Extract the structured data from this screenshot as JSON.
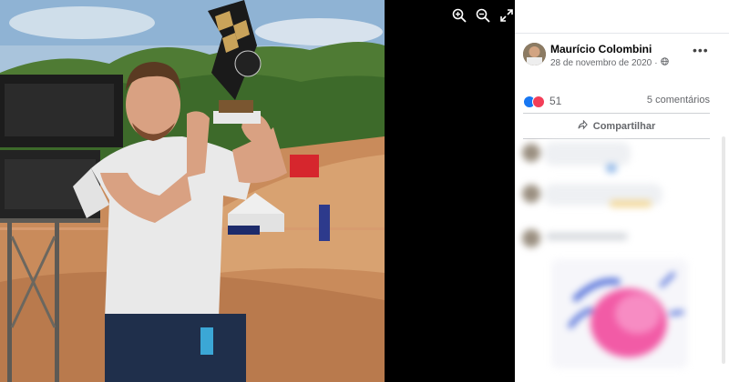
{
  "viewer": {
    "tools": [
      {
        "name": "zoom-in-icon"
      },
      {
        "name": "zoom-out-icon"
      },
      {
        "name": "fullscreen-icon"
      }
    ]
  },
  "post": {
    "author": "Maurício Colombini",
    "date": "28 de novembro de 2020",
    "privacy_icon": "globe-icon",
    "more_label": "•••",
    "reactions_count": "51",
    "comments_label": "5 comentários",
    "share_label": "Compartilhar"
  },
  "colors": {
    "like": "#1877f2",
    "love": "#f33e58",
    "panel_bg": "#ffffff",
    "viewer_bg": "#000000"
  }
}
